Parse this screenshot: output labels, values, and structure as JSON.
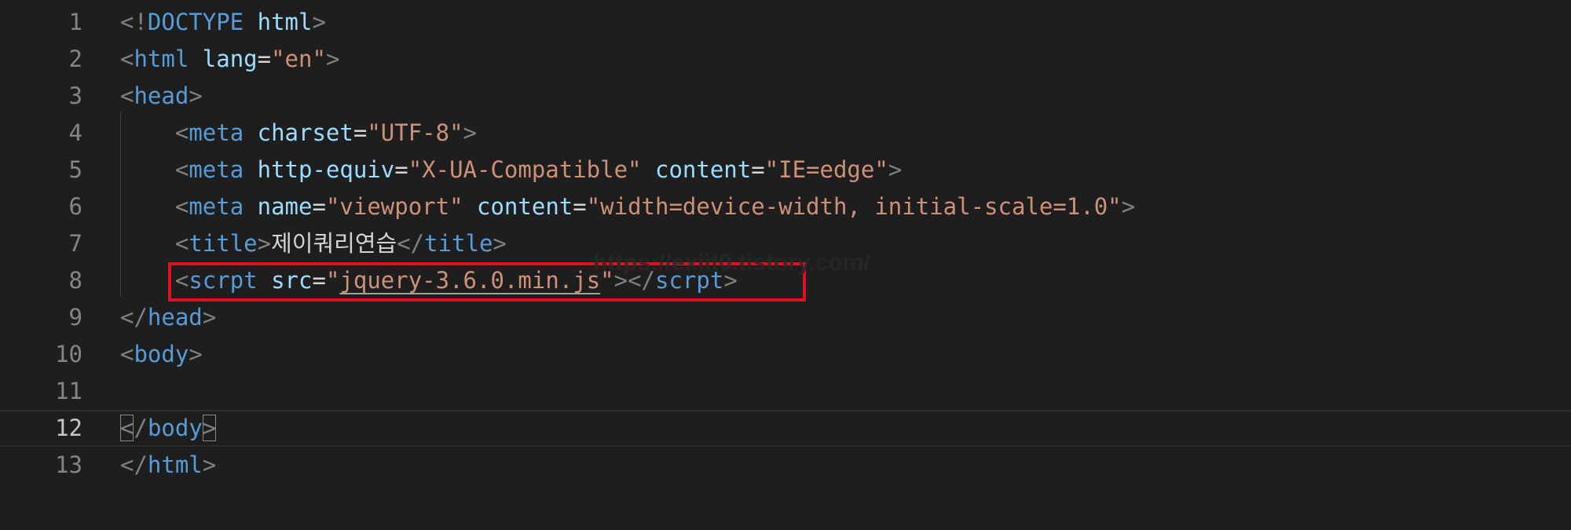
{
  "editor": {
    "watermark": "https://exiit0.tistory.com/",
    "lines": [
      {
        "num": "1",
        "tokens": [
          [
            "punct",
            "<!"
          ],
          [
            "tag",
            "DOCTYPE"
          ],
          [
            "txt",
            " "
          ],
          [
            "attr",
            "html"
          ],
          [
            "punct",
            ">"
          ]
        ]
      },
      {
        "num": "2",
        "tokens": [
          [
            "punct",
            "<"
          ],
          [
            "tag",
            "html"
          ],
          [
            "txt",
            " "
          ],
          [
            "attr",
            "lang"
          ],
          [
            "eq",
            "="
          ],
          [
            "str",
            "\"en\""
          ],
          [
            "punct",
            ">"
          ]
        ]
      },
      {
        "num": "3",
        "tokens": [
          [
            "punct",
            "<"
          ],
          [
            "tag",
            "head"
          ],
          [
            "punct",
            ">"
          ]
        ]
      },
      {
        "num": "4",
        "tokens": [
          [
            "txt",
            "    "
          ],
          [
            "punct",
            "<"
          ],
          [
            "tag",
            "meta"
          ],
          [
            "txt",
            " "
          ],
          [
            "attr",
            "charset"
          ],
          [
            "eq",
            "="
          ],
          [
            "str",
            "\"UTF-8\""
          ],
          [
            "punct",
            ">"
          ]
        ]
      },
      {
        "num": "5",
        "tokens": [
          [
            "txt",
            "    "
          ],
          [
            "punct",
            "<"
          ],
          [
            "tag",
            "meta"
          ],
          [
            "txt",
            " "
          ],
          [
            "attr",
            "http-equiv"
          ],
          [
            "eq",
            "="
          ],
          [
            "str",
            "\"X-UA-Compatible\""
          ],
          [
            "txt",
            " "
          ],
          [
            "attr",
            "content"
          ],
          [
            "eq",
            "="
          ],
          [
            "str",
            "\"IE=edge\""
          ],
          [
            "punct",
            ">"
          ]
        ]
      },
      {
        "num": "6",
        "tokens": [
          [
            "txt",
            "    "
          ],
          [
            "punct",
            "<"
          ],
          [
            "tag",
            "meta"
          ],
          [
            "txt",
            " "
          ],
          [
            "attr",
            "name"
          ],
          [
            "eq",
            "="
          ],
          [
            "str",
            "\"viewport\""
          ],
          [
            "txt",
            " "
          ],
          [
            "attr",
            "content"
          ],
          [
            "eq",
            "="
          ],
          [
            "str",
            "\"width=device-width, initial-scale=1.0\""
          ],
          [
            "punct",
            ">"
          ]
        ]
      },
      {
        "num": "7",
        "tokens": [
          [
            "txt",
            "    "
          ],
          [
            "punct",
            "<"
          ],
          [
            "tag",
            "title"
          ],
          [
            "punct",
            ">"
          ],
          [
            "txt",
            "제이쿼리연습"
          ],
          [
            "punct",
            "</"
          ],
          [
            "tag",
            "title"
          ],
          [
            "punct",
            ">"
          ]
        ]
      },
      {
        "num": "8",
        "tokens": [
          [
            "txt",
            "    "
          ],
          [
            "punct",
            "<"
          ],
          [
            "tag",
            "scrpt"
          ],
          [
            "txt",
            " "
          ],
          [
            "attr",
            "src"
          ],
          [
            "eq",
            "="
          ],
          [
            "str",
            "\""
          ],
          [
            "strsq",
            "jquery-3.6.0.min.js"
          ],
          [
            "str",
            "\""
          ],
          [
            "punct",
            "></"
          ],
          [
            "tag",
            "scrpt"
          ],
          [
            "punct",
            ">"
          ]
        ]
      },
      {
        "num": "9",
        "tokens": [
          [
            "punct",
            "</"
          ],
          [
            "tag",
            "head"
          ],
          [
            "punct",
            ">"
          ]
        ]
      },
      {
        "num": "10",
        "tokens": [
          [
            "punct",
            "<"
          ],
          [
            "tag",
            "body"
          ],
          [
            "punct",
            ">"
          ]
        ]
      },
      {
        "num": "11",
        "tokens": []
      },
      {
        "num": "12",
        "tokens": [
          [
            "punctbm",
            "<"
          ],
          [
            "punct",
            "/"
          ],
          [
            "tag",
            "body"
          ],
          [
            "punctbm",
            ">"
          ]
        ]
      },
      {
        "num": "13",
        "tokens": [
          [
            "punct",
            "</"
          ],
          [
            "tag",
            "html"
          ],
          [
            "punct",
            ">"
          ]
        ]
      }
    ]
  }
}
